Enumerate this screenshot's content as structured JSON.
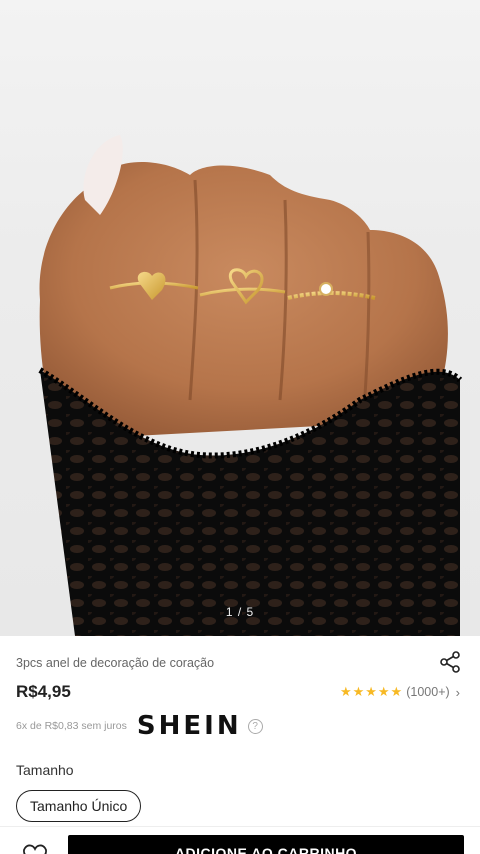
{
  "gallery": {
    "pager": "1 / 5",
    "image": "hand-with-rings-photo"
  },
  "product": {
    "title": "3pcs anel de decoração de coração",
    "price": "R$4,95",
    "rating_stars": "★★★★★",
    "reviews": "(1000+)",
    "installments": "6x de R$0,83 sem juros",
    "brand": "SHEIN",
    "help": "?",
    "size_label": "Tamanho",
    "size_option": "Tamanho Único"
  },
  "actions": {
    "add_to_cart": "ADICIONE AO CARRINHO"
  },
  "colors": {
    "star": "#f7b924",
    "button": "#000000"
  }
}
